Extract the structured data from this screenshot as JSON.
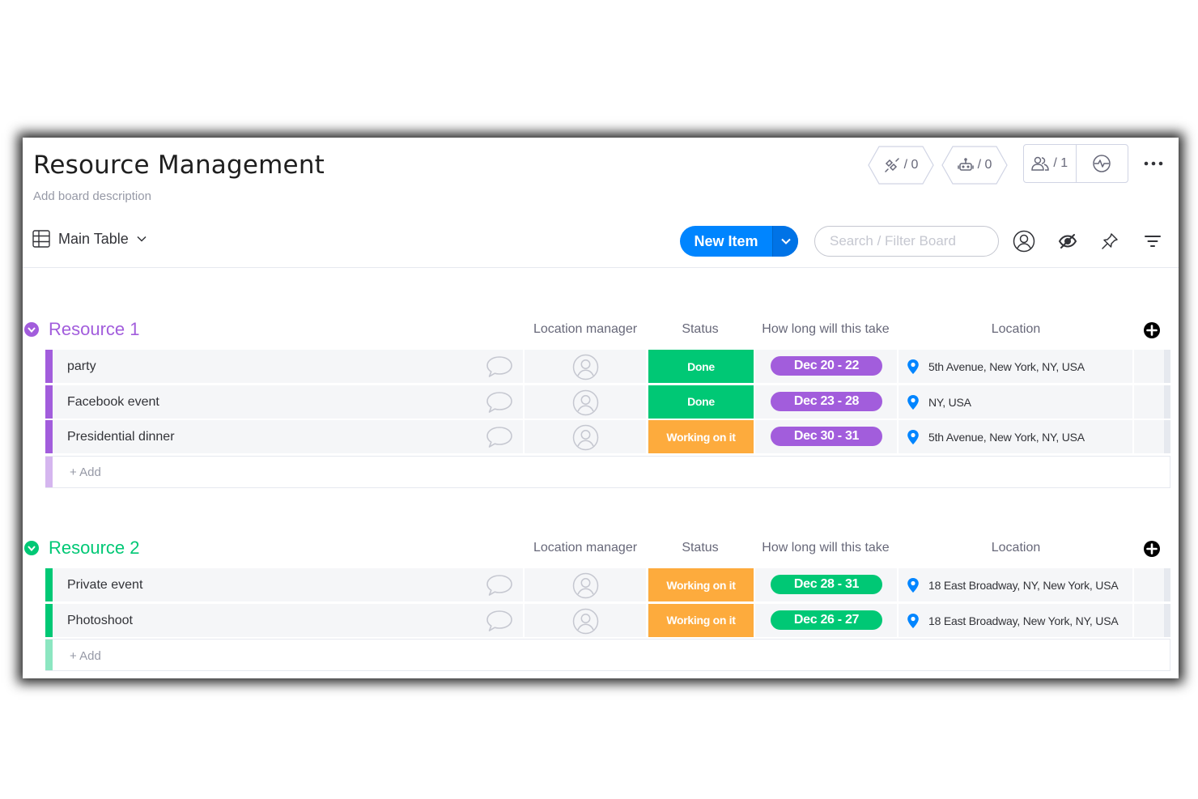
{
  "board": {
    "title": "Resource Management",
    "description": "Add board description"
  },
  "header_actions": {
    "integrations_count": "/ 0",
    "automations_count": "/ 0",
    "members_count": "/ 1"
  },
  "toolbar": {
    "view_label": "Main Table",
    "new_item_label": "New Item",
    "search_placeholder": "Search / Filter Board"
  },
  "columns": [
    "Location manager",
    "Status",
    "How long will this take",
    "Location"
  ],
  "colors": {
    "resource1": "#a25ddc",
    "resource2": "#00c875",
    "done": "#00c875",
    "working": "#fdab3d",
    "primary": "#0085ff",
    "location_pin": "#0085ff"
  },
  "groups": [
    {
      "title": "Resource 1",
      "color": "#a25ddc",
      "add_placeholder": "+ Add",
      "items": [
        {
          "name": "party",
          "status": "Done",
          "status_color": "#00c875",
          "timeline": "Dec 20 - 22",
          "location": "5th Avenue, New York, NY, USA"
        },
        {
          "name": "Facebook event",
          "status": "Done",
          "status_color": "#00c875",
          "timeline": "Dec 23 - 28",
          "location": "NY, USA"
        },
        {
          "name": "Presidential dinner",
          "status": "Working on it",
          "status_color": "#fdab3d",
          "timeline": "Dec 30 - 31",
          "location": "5th Avenue, New York, NY, USA"
        }
      ]
    },
    {
      "title": "Resource 2",
      "color": "#00c875",
      "add_placeholder": "+ Add",
      "items": [
        {
          "name": "Private event",
          "status": "Working on it",
          "status_color": "#fdab3d",
          "timeline": "Dec 28 - 31",
          "location": "18 East Broadway, NY, New York, USA"
        },
        {
          "name": "Photoshoot",
          "status": "Working on it",
          "status_color": "#fdab3d",
          "timeline": "Dec 26 - 27",
          "location": "18 East Broadway, New York, NY, USA"
        }
      ]
    }
  ]
}
